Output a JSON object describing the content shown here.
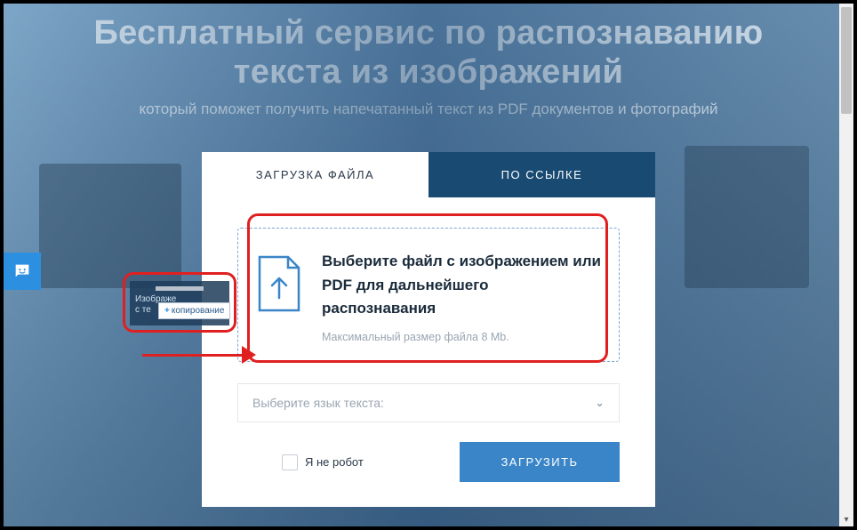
{
  "hero": {
    "title_line1": "Бесплатный сервис по распознаванию",
    "title_line2": "текста из изображений",
    "subtitle": "который поможет получить напечатанный текст из PDF документов и фотографий"
  },
  "tabs": {
    "upload": "ЗАГРУЗКА ФАЙЛА",
    "url": "ПО ССЫЛКЕ"
  },
  "dropzone": {
    "title": "Выберите файл с изображением или PDF для дальнейшего распознавания",
    "hint": "Максимальный размер файла 8 Mb."
  },
  "language_select": {
    "placeholder": "Выберите язык текста:"
  },
  "captcha": {
    "label": "Я не робот"
  },
  "submit": {
    "label": "ЗАГРУЗИТЬ"
  },
  "drag_preview": {
    "line1": "Изображе",
    "line2": "с те",
    "badge": "копирование"
  },
  "colors": {
    "accent": "#3a85c7",
    "highlight": "#e02020",
    "tab_inactive_bg": "#184a72"
  }
}
